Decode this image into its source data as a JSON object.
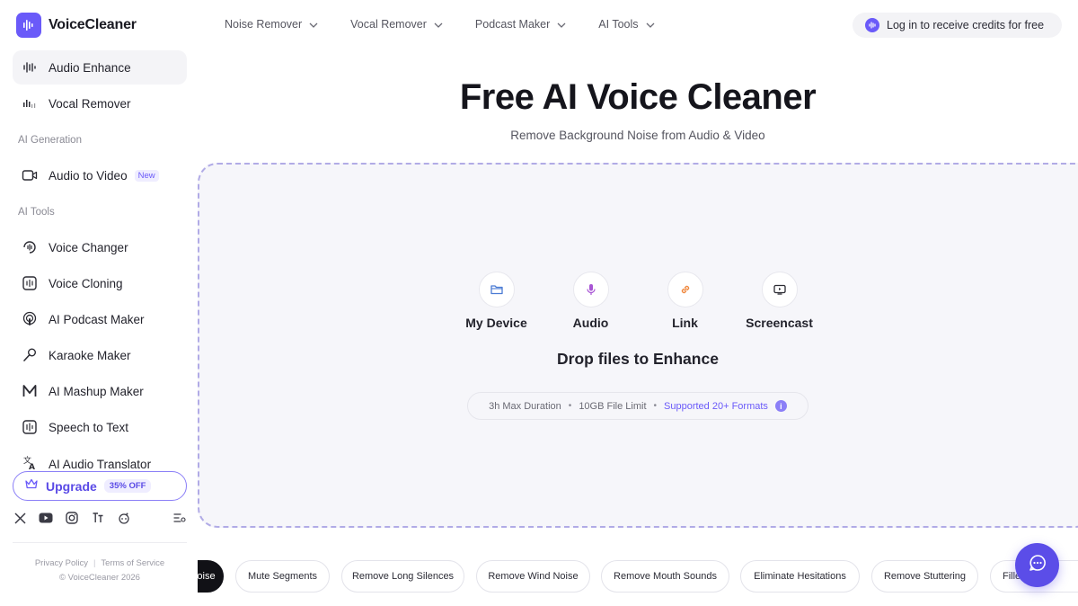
{
  "brand": {
    "name": "VoiceCleaner"
  },
  "sidebar": {
    "items": [
      {
        "label": "Audio Enhance",
        "icon": "waveform-sparkle-icon",
        "active": true
      },
      {
        "label": "Vocal Remover",
        "icon": "vocal-bars-icon"
      }
    ],
    "section_generation": "AI Generation",
    "generation_items": [
      {
        "label": "Audio to Video",
        "icon": "video-icon",
        "badge": "New"
      }
    ],
    "section_tools": "AI Tools",
    "tool_items": [
      {
        "label": "Voice Changer",
        "icon": "voice-changer-icon"
      },
      {
        "label": "Voice Cloning",
        "icon": "voice-cloning-icon"
      },
      {
        "label": "AI Podcast Maker",
        "icon": "podcast-icon"
      },
      {
        "label": "Karaoke Maker",
        "icon": "microphone-icon"
      },
      {
        "label": "AI Mashup Maker",
        "icon": "mashup-m-icon"
      },
      {
        "label": "Speech to Text",
        "icon": "speech-to-text-icon"
      },
      {
        "label": "AI Audio Translator",
        "icon": "translate-icon"
      }
    ],
    "upgrade": {
      "label": "Upgrade",
      "badge": "35% OFF"
    },
    "socials": [
      "x-icon",
      "youtube-icon",
      "instagram-icon",
      "tiktok-icon",
      "reddit-icon"
    ],
    "legal": {
      "privacy": "Privacy Policy",
      "terms": "Terms of Service",
      "copyright": "© VoiceCleaner 2026"
    }
  },
  "topnav": {
    "items": [
      "Noise Remover",
      "Vocal Remover",
      "Podcast Maker",
      "AI Tools"
    ],
    "login": "Log in to receive credits for free"
  },
  "hero": {
    "title": "Free AI Voice Cleaner",
    "subtitle": "Remove Background Noise from Audio & Video"
  },
  "dropzone": {
    "sources": [
      {
        "label": "My Device",
        "icon": "folder-icon",
        "color": "#4a7bd4"
      },
      {
        "label": "Audio",
        "icon": "microphone-icon",
        "color": "#a855d4"
      },
      {
        "label": "Link",
        "icon": "link-icon",
        "color": "#f0883e"
      },
      {
        "label": "Screencast",
        "icon": "screen-icon",
        "color": "#2b2b33"
      }
    ],
    "drop_text": "Drop files to Enhance",
    "limits": {
      "duration": "3h Max Duration",
      "size": "10GB File Limit",
      "formats": "Supported 20+ Formats",
      "info": "i"
    }
  },
  "chips": [
    "oise",
    "Mute Segments",
    "Remove Long Silences",
    "Remove Wind Noise",
    "Remove Mouth Sounds",
    "Eliminate Hesitations",
    "Remove Stuttering",
    "Fille"
  ],
  "colors": {
    "accent": "#6a5af9",
    "dropzone_bg": "#f6f6fa",
    "dashed_border": "#b1abe6"
  }
}
